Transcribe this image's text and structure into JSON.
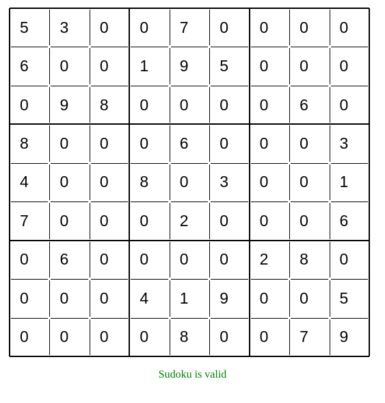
{
  "sudoku": {
    "grid": [
      [
        "5",
        "3",
        "0",
        "0",
        "7",
        "0",
        "0",
        "0",
        "0"
      ],
      [
        "6",
        "0",
        "0",
        "1",
        "9",
        "5",
        "0",
        "0",
        "0"
      ],
      [
        "0",
        "9",
        "8",
        "0",
        "0",
        "0",
        "0",
        "6",
        "0"
      ],
      [
        "8",
        "0",
        "0",
        "0",
        "6",
        "0",
        "0",
        "0",
        "3"
      ],
      [
        "4",
        "0",
        "0",
        "8",
        "0",
        "3",
        "0",
        "0",
        "1"
      ],
      [
        "7",
        "0",
        "0",
        "0",
        "2",
        "0",
        "0",
        "0",
        "6"
      ],
      [
        "0",
        "6",
        "0",
        "0",
        "0",
        "0",
        "2",
        "8",
        "0"
      ],
      [
        "0",
        "0",
        "0",
        "4",
        "1",
        "9",
        "0",
        "0",
        "5"
      ],
      [
        "0",
        "0",
        "0",
        "0",
        "8",
        "0",
        "0",
        "7",
        "9"
      ]
    ]
  },
  "status": {
    "message": "Sudoku is valid",
    "color": "#008000"
  }
}
